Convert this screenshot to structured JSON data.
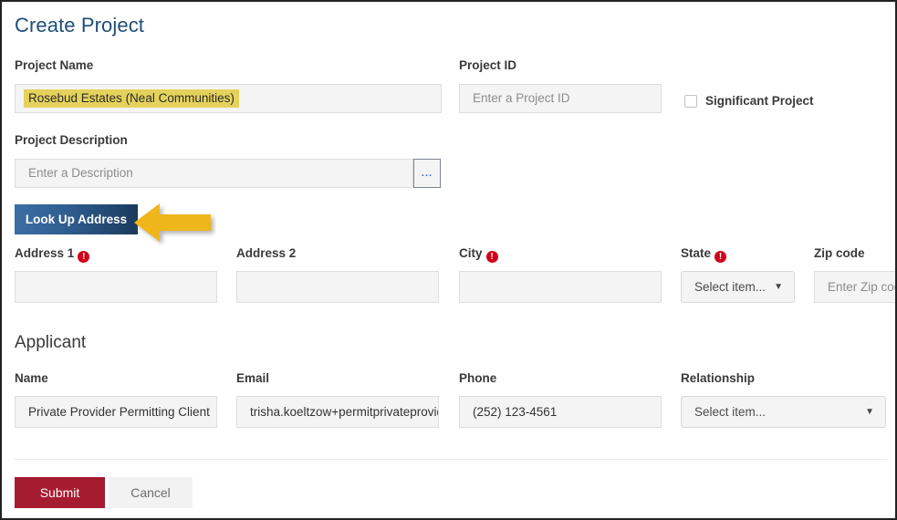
{
  "header": {
    "title": "Create Project"
  },
  "project": {
    "name_label": "Project Name",
    "name_value": "Rosebud Estates (Neal Communities)",
    "id_label": "Project ID",
    "id_placeholder": "Enter a Project ID",
    "significant_label": "Significant Project",
    "description_label": "Project Description",
    "description_placeholder": "Enter a Description",
    "description_more": "...",
    "lookup_button": "Look Up Address"
  },
  "address": {
    "address1_label": "Address 1",
    "address1_value": "",
    "address2_label": "Address 2",
    "address2_value": "",
    "city_label": "City",
    "city_value": "",
    "state_label": "State",
    "state_value": "Select item...",
    "zip_label": "Zip code",
    "zip_placeholder": "Enter Zip code",
    "required_marker": "!"
  },
  "applicant": {
    "section_title": "Applicant",
    "name_label": "Name",
    "name_value": "Private Provider Permitting Client",
    "email_label": "Email",
    "email_value": "trisha.koeltzow+permitprivateprovider@gmail.com",
    "phone_label": "Phone",
    "phone_value": "(252) 123-4561",
    "relationship_label": "Relationship",
    "relationship_value": "Select item..."
  },
  "footer": {
    "submit_label": "Submit",
    "cancel_label": "Cancel"
  },
  "annotation": {
    "arrow_color": "#efb61e",
    "arrow_direction": "left"
  },
  "colors": {
    "title": "#1f4e79",
    "submit": "#a51c30",
    "required": "#d0021b",
    "highlight": "#e5d25c",
    "button_gradient_start": "#3c6ea5",
    "button_gradient_end": "#1b3a5c"
  }
}
